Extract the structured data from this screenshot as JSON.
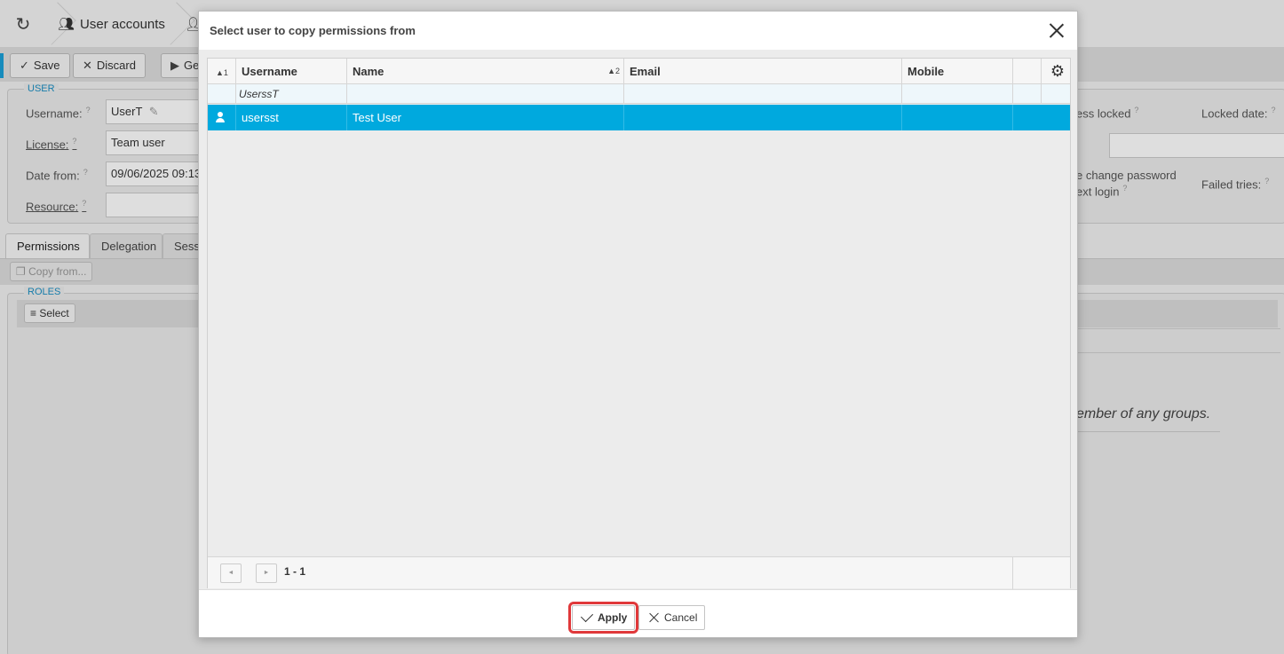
{
  "app": {
    "breadcrumbs": [
      "User accounts"
    ],
    "toolbar": {
      "save": "Save",
      "discard": "Discard",
      "third": "Ge"
    },
    "user_section": {
      "legend": "USER",
      "username_label": "Username:",
      "username_value": "UserT",
      "license_label": "License:",
      "license_value": "Team user",
      "date_from_label": "Date from:",
      "date_from_value": "09/06/2025 09:13",
      "resource_label": "Resource:",
      "access_locked_label": "ess locked",
      "locked_date_label": "Locked date:",
      "change_password_label_1": "e change password",
      "change_password_label_2": "ext login",
      "failed_tries_label": "Failed tries:"
    },
    "tabs": [
      "Permissions",
      "Delegation",
      "Sessi"
    ],
    "copy_from": "Copy from...",
    "roles_legend": "ROLES",
    "select_button": "Select",
    "groups_message": "ember of any groups."
  },
  "dialog": {
    "title": "Select user to copy permissions from",
    "columns": {
      "sort1": "▲1",
      "username": "Username",
      "name": "Name",
      "sort2": "▲2",
      "email": "Email",
      "mobile": "Mobile"
    },
    "filter": {
      "username": "UserssT"
    },
    "rows": [
      {
        "username": "usersst",
        "name": "Test User",
        "email": "",
        "mobile": ""
      }
    ],
    "pagination": {
      "info": "1 - 1",
      "prev_icon": "◄",
      "next_icon": "►"
    },
    "buttons": {
      "apply": "Apply",
      "cancel": "Cancel"
    },
    "colors": {
      "selected_row": "#00a9de",
      "highlight": "#e0383a"
    }
  }
}
